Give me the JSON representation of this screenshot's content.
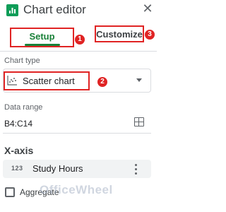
{
  "header": {
    "title": "Chart editor",
    "close_icon": "close-icon",
    "logo_icon": "sheets-chart-icon"
  },
  "tabs": [
    {
      "label": "Setup",
      "active": true,
      "badge": "1"
    },
    {
      "label": "Customize",
      "active": false,
      "badge": "3"
    }
  ],
  "chart_type": {
    "label": "Chart type",
    "value": "Scatter chart",
    "icon": "scatter-chart-icon",
    "badge": "2"
  },
  "data_range": {
    "label": "Data range",
    "value": "B4:C14",
    "icon": "grid-icon"
  },
  "x_axis": {
    "title": "X-axis",
    "series_type": "123",
    "series_name": "Study Hours",
    "menu_icon": "more-vert-icon"
  },
  "aggregate": {
    "label": "Aggregate",
    "checked": false
  },
  "watermark": "OfficeWheel",
  "colors": {
    "highlight": "#e02424",
    "active_tab": "#188038",
    "brand": "#0f9d58"
  }
}
